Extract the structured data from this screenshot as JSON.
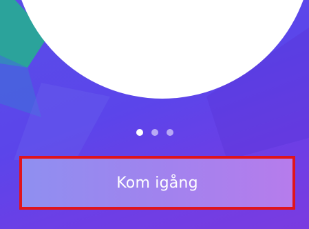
{
  "pager": {
    "count": 3,
    "active_index": 0
  },
  "cta": {
    "label": "Kom igång"
  },
  "colors": {
    "background_start": "#5a4ee8",
    "background_end": "#7a3be0",
    "teal_accent": "#2ba39b",
    "button_fill_left": "#8f8ff0",
    "button_fill_right": "#b67cec",
    "highlight_border": "#e0141c"
  }
}
